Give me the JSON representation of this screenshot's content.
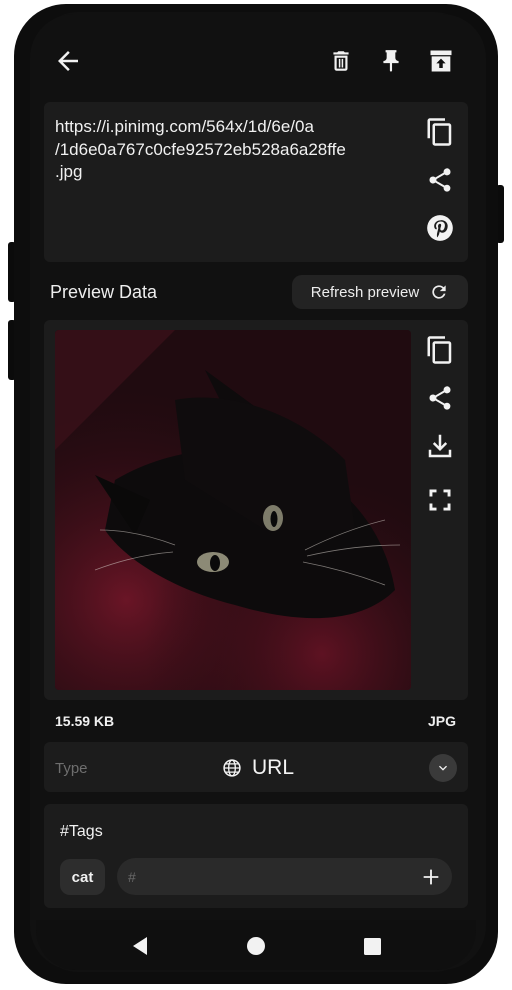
{
  "header": {
    "back_icon": "arrow-left-icon",
    "actions": [
      "trash-icon",
      "pin-icon",
      "archive-icon"
    ]
  },
  "link": {
    "url": "https://i.pinimg.com/564x/1d/6e/0a/1d6e0a767c0cfe92572eb528a6a28ffe.jpg",
    "url_lines": [
      "https://i.pinimg.com/564x/1d/6e/0a",
      "/1d6e0a767c0cfe92572eb528a6a28ffe",
      ".jpg"
    ],
    "actions": [
      "copy-icon",
      "share-icon",
      "pinterest-icon"
    ]
  },
  "preview": {
    "title": "Preview Data",
    "refresh_label": "Refresh preview",
    "image_subject": "black-cat-photo",
    "actions": [
      "copy-icon",
      "share-icon",
      "download-icon",
      "fullscreen-icon"
    ],
    "file_size": "15.59 KB",
    "file_type": "JPG"
  },
  "type": {
    "label": "Type",
    "value": "URL",
    "icon": "globe-icon"
  },
  "tags": {
    "title": "#Tags",
    "items": [
      "cat"
    ],
    "input_placeholder": "#"
  },
  "nav": [
    "back-triangle-icon",
    "home-circle-icon",
    "recents-square-icon"
  ],
  "colors": {
    "background": "#111111",
    "card": "#1c1c1c",
    "text": "#f1f1f1",
    "muted": "#6e6e6e"
  }
}
